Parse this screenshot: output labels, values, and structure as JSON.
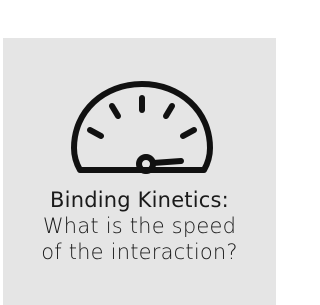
{
  "card": {
    "background": "#e5e5e5",
    "icon": "speedometer-icon",
    "title": "Binding Kinetics:",
    "body_lines": [
      "What is the speed",
      "of the interaction?"
    ],
    "text_color": "#1a1a1a"
  }
}
